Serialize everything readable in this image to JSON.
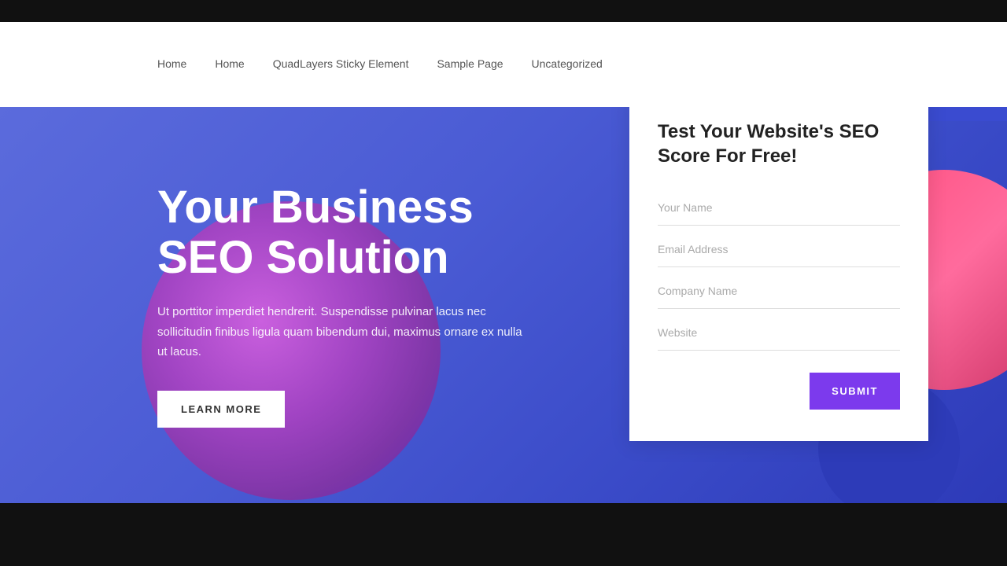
{
  "topBar": {},
  "nav": {
    "links": [
      {
        "label": "Home",
        "href": "#"
      },
      {
        "label": "Home",
        "href": "#"
      },
      {
        "label": "QuadLayers Sticky Element",
        "href": "#"
      },
      {
        "label": "Sample Page",
        "href": "#"
      },
      {
        "label": "Uncategorized",
        "href": "#"
      }
    ]
  },
  "hero": {
    "title": "Your Business SEO Solution",
    "text": "Ut porttitor imperdiet hendrerit. Suspendisse pulvinar lacus nec sollicitudin finibus ligula quam bibendum dui, maximus ornare ex nulla ut lacus.",
    "learnMoreLabel": "LEARN MORE"
  },
  "form": {
    "title": "Test Your Website's SEO Score For Free!",
    "fields": [
      {
        "placeholder": "Your Name",
        "type": "text",
        "name": "your-name"
      },
      {
        "placeholder": "Email Address",
        "type": "email",
        "name": "email-address"
      },
      {
        "placeholder": "Company Name",
        "type": "text",
        "name": "company-name"
      },
      {
        "placeholder": "Website",
        "type": "text",
        "name": "website"
      }
    ],
    "submitLabel": "SUBMIT"
  }
}
